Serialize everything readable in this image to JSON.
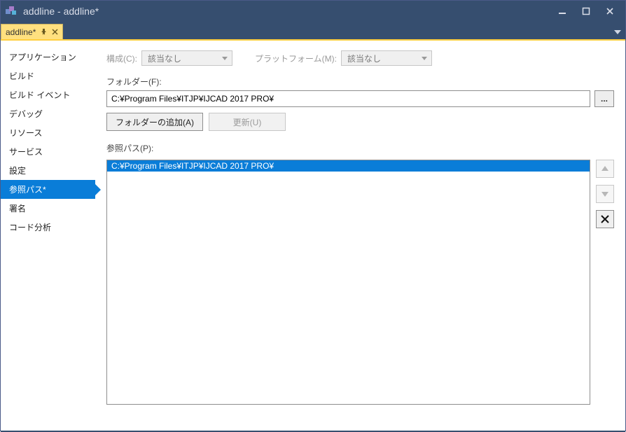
{
  "window": {
    "title": "addline - addline*"
  },
  "tabs": [
    {
      "label": "addline*"
    }
  ],
  "sidenav": {
    "items": [
      {
        "label": "アプリケーション"
      },
      {
        "label": "ビルド"
      },
      {
        "label": "ビルド イベント"
      },
      {
        "label": "デバッグ"
      },
      {
        "label": "リソース"
      },
      {
        "label": "サービス"
      },
      {
        "label": "設定"
      },
      {
        "label": "参照パス*",
        "selected": true
      },
      {
        "label": "署名"
      },
      {
        "label": "コード分析"
      }
    ]
  },
  "toprow": {
    "config_label": "構成(C):",
    "config_value": "該当なし",
    "platform_label": "プラットフォーム(M):",
    "platform_value": "該当なし"
  },
  "folder": {
    "label": "フォルダー(F):",
    "value": "C:¥Program Files¥ITJP¥IJCAD 2017 PRO¥",
    "browse": "..."
  },
  "buttons": {
    "add_folder": "フォルダーの追加(A)",
    "update": "更新(U)"
  },
  "refpaths": {
    "label": "参照パス(P):",
    "items": [
      "C:¥Program Files¥ITJP¥IJCAD 2017 PRO¥"
    ]
  }
}
